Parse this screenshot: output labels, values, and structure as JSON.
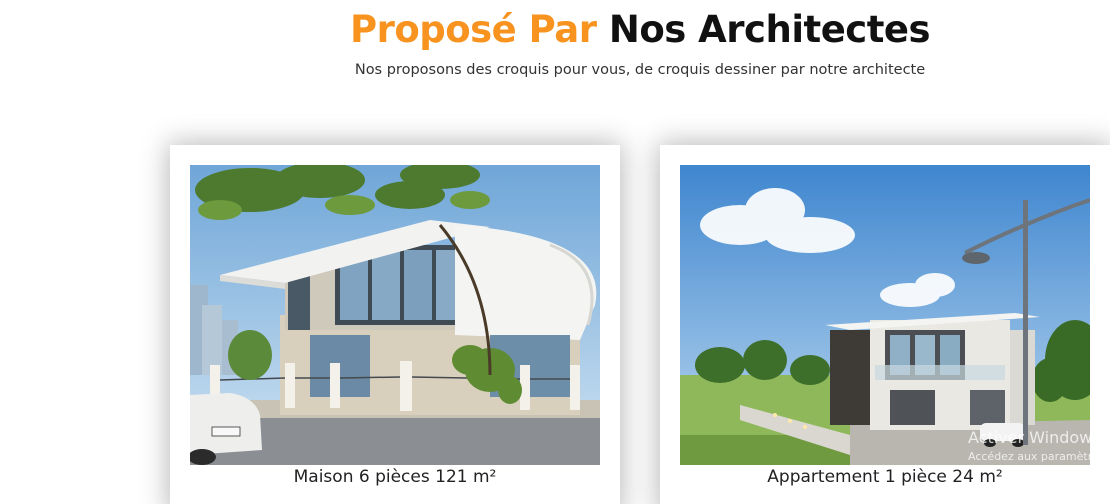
{
  "heading": {
    "accent": "Proposé Par",
    "dark": "Nos Architectes"
  },
  "subtitle": "Nos proposons des croquis pour vous, de croquis dessiner par notre architecte",
  "cards": [
    {
      "caption": "Maison 6 pièces 121 m²"
    },
    {
      "caption": "Appartement 1 pièce 24 m²"
    }
  ],
  "watermark": {
    "title": "Activer Windows",
    "subtitle": "Accédez aux paramètres"
  },
  "colors": {
    "accent": "#f7931e",
    "heading_dark": "#111111",
    "text": "#333333"
  }
}
